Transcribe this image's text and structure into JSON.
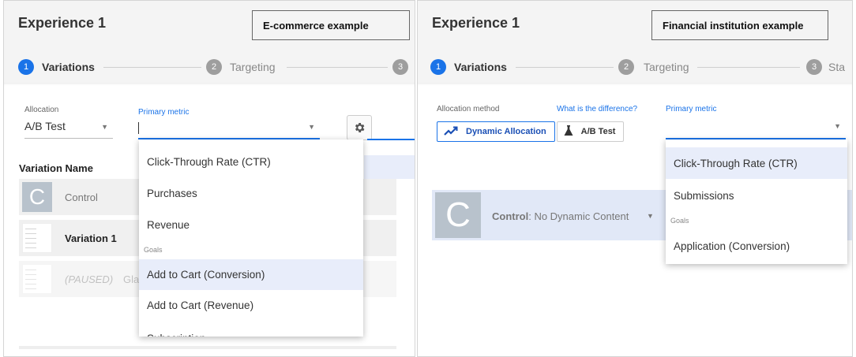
{
  "left": {
    "experience_title": "Experience 1",
    "example_label": "E-commerce example",
    "steps": [
      {
        "number": "1",
        "label": "Variations"
      },
      {
        "number": "2",
        "label": "Targeting"
      },
      {
        "number": "3",
        "label": ""
      }
    ],
    "allocation": {
      "caption": "Allocation",
      "value": "A/B Test"
    },
    "primary_metric": {
      "caption": "Primary metric",
      "value": ""
    },
    "variation_header": "Variation Name",
    "variations": [
      {
        "avatar": "C",
        "name": "Control"
      },
      {
        "name": "Variation 1"
      },
      {
        "status": "(PAUSED)",
        "name": "Gla"
      }
    ],
    "dropdown": {
      "items_top": [
        "Click-Through Rate (CTR)",
        "Purchases",
        "Revenue"
      ],
      "group_label": "Goals",
      "items_goals": [
        "Add to Cart (Conversion)",
        "Add to Cart (Revenue)",
        "Subscription"
      ]
    }
  },
  "right": {
    "experience_title": "Experience 1",
    "example_label": "Financial institution example",
    "steps": [
      {
        "number": "1",
        "label": "Variations"
      },
      {
        "number": "2",
        "label": "Targeting"
      },
      {
        "number": "3",
        "label": "Sta"
      }
    ],
    "allocation_method": {
      "caption": "Allocation method",
      "help_link": "What is the difference?"
    },
    "toggles": [
      {
        "icon": "trending-up-icon",
        "label": "Dynamic Allocation"
      },
      {
        "icon": "flask-icon",
        "label": "A/B Test"
      }
    ],
    "primary_metric": {
      "caption": "Primary metric",
      "value": ""
    },
    "control_row": {
      "avatar": "C",
      "label_bold": "Control",
      "label_rest": ": No Dynamic Content"
    },
    "dropdown": {
      "items_top": [
        "Click-Through Rate (CTR)",
        "Submissions"
      ],
      "group_label": "Goals",
      "items_goals": [
        "Application (Conversion)"
      ]
    }
  },
  "colors": {
    "accent": "#1a73e8",
    "inactive_step": "#9e9e9e",
    "highlight": "#e8edfa",
    "dynamic_row": "#e1e8f7"
  }
}
